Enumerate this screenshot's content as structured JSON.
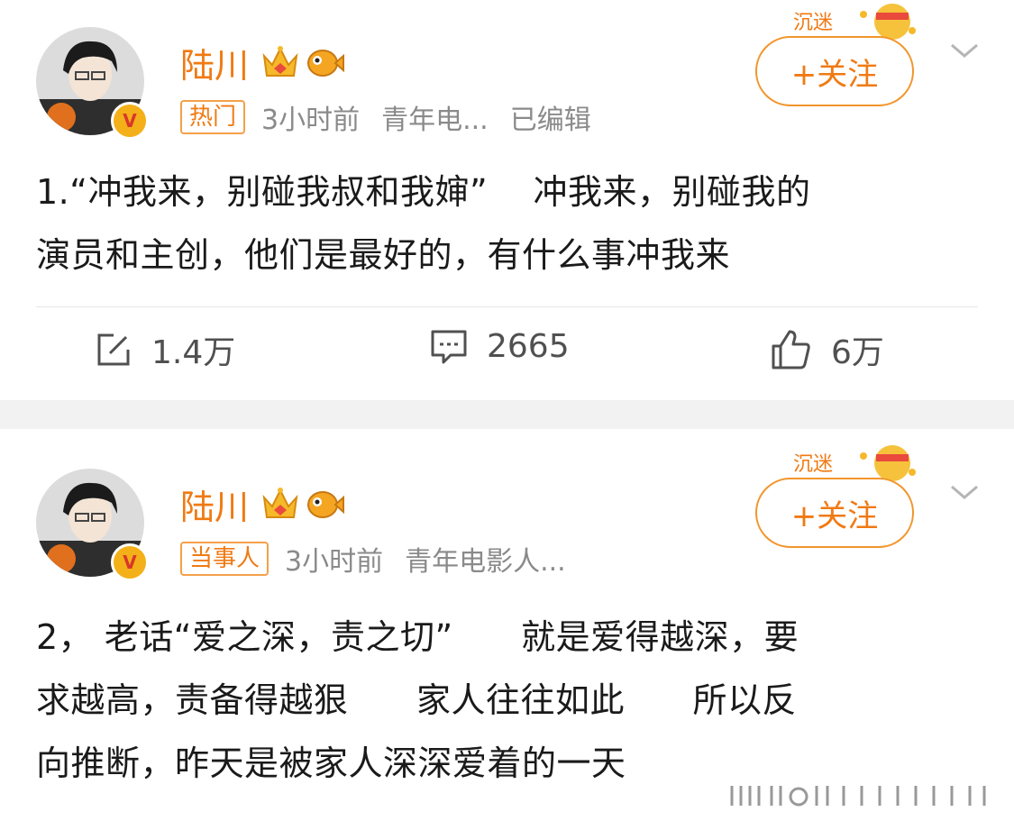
{
  "posts": [
    {
      "author": "陆川",
      "tag": "热门",
      "time": "3小时前",
      "source": "青年电...",
      "edited": "已编辑",
      "follow_label": "+关注",
      "content": "1.“冲我来，别碰我叔和我婶”    冲我来，别碰我的\n演员和主创，他们是最好的，有什么事冲我来",
      "actions": {
        "repost": "1.4万",
        "comment": "2665",
        "like": "6万"
      }
    },
    {
      "author": "陆川",
      "tag": "当事人",
      "time": "3小时前",
      "source": "青年电影人...",
      "follow_label": "+关注",
      "content": "2， 老话“爱之深，责之切”      就是爱得越深，要\n求越高，责备得越狠      家人往往如此      所以反\n向推断，昨天是被家人深深爱着的一天"
    }
  ],
  "colors": {
    "accent": "#f07a13",
    "follow_border": "#f2952b",
    "meta_gray": "#8a8a8a",
    "separator_band": "#f2f2f2"
  },
  "icons": {
    "repost": "edit-square-icon",
    "comment": "comment-bubble-icon",
    "like": "thumbs-up-icon",
    "crown": "crown-icon",
    "fish": "fish-icon",
    "chevron": "chevron-down-icon",
    "verified": "verified-v-icon"
  }
}
